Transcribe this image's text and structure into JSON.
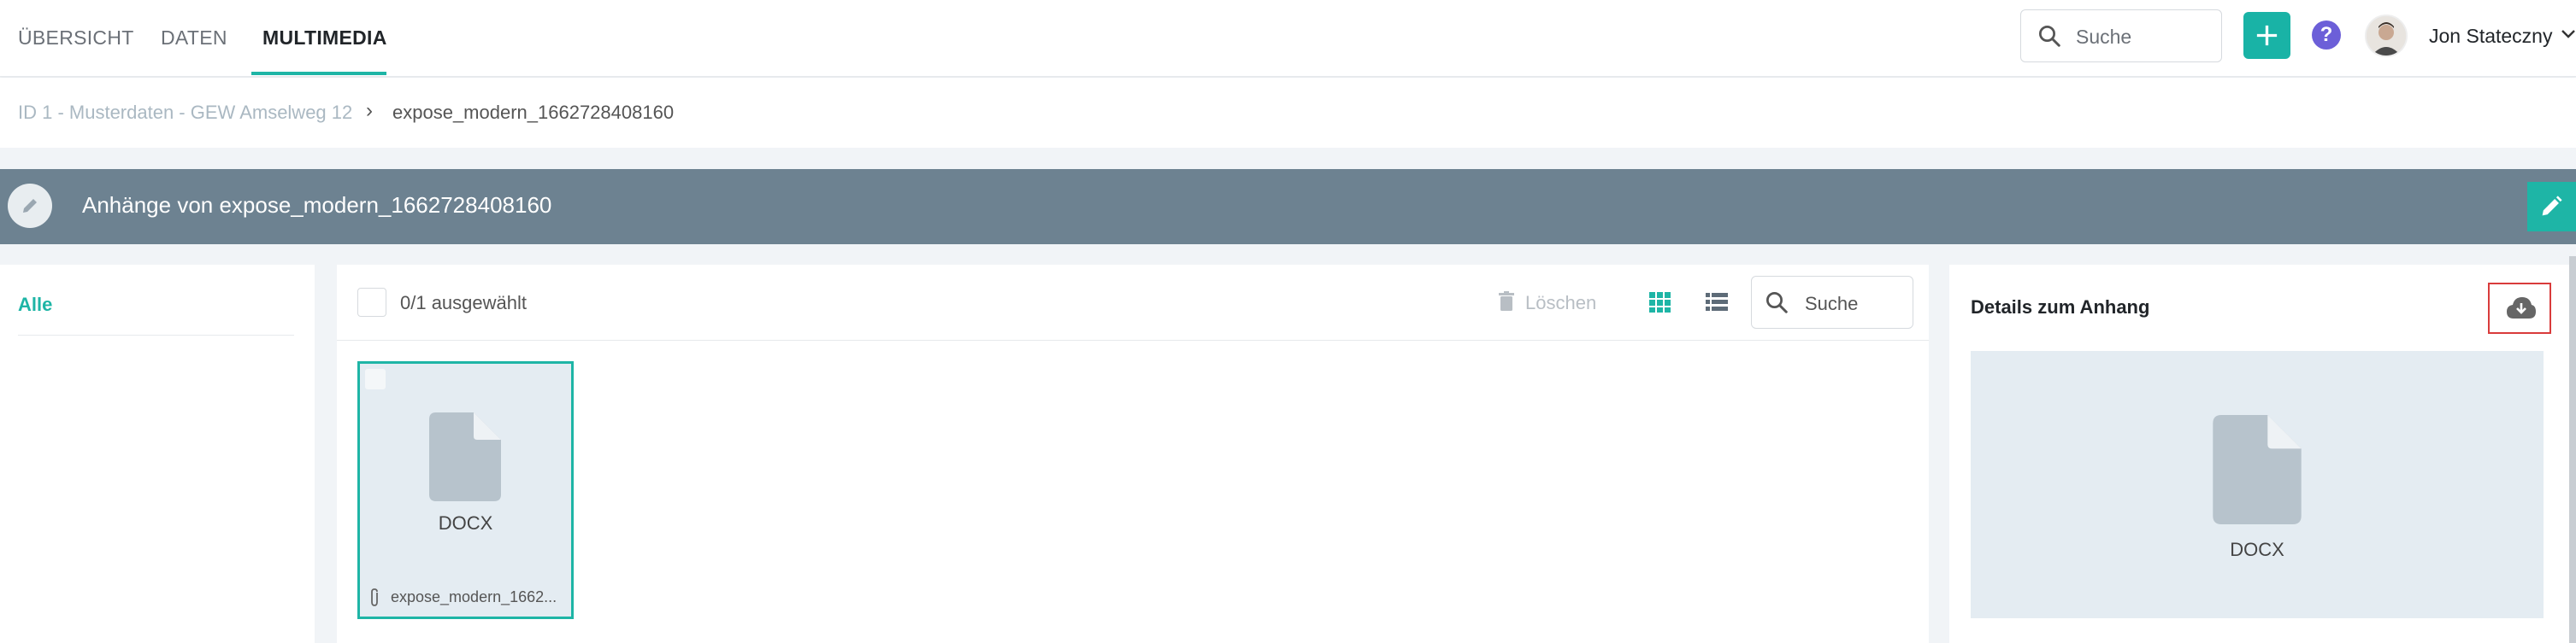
{
  "nav": {
    "tabs": [
      {
        "label": "ÜBERSICHT"
      },
      {
        "label": "DATEN"
      },
      {
        "label": "MULTIMEDIA",
        "active": true
      }
    ],
    "search_placeholder": "Suche",
    "help_label": "?",
    "user_name": "Jon Stateczny"
  },
  "breadcrumb": {
    "parent": "ID 1 - Musterdaten - GEW Amselweg 12",
    "separator": "›",
    "current": "expose_modern_1662728408160"
  },
  "header": {
    "title": "Anhänge von expose_modern_1662728408160"
  },
  "sidebar": {
    "filter_all": "Alle"
  },
  "files": {
    "selection_count": "0/1 ausgewählt",
    "delete_label": "Löschen",
    "search_placeholder": "Suche",
    "items": [
      {
        "type": "DOCX",
        "name": "expose_modern_1662..."
      }
    ]
  },
  "details": {
    "title": "Details zum Anhang",
    "preview_type": "DOCX"
  },
  "colors": {
    "accent": "#1eb5a6",
    "header_band": "#6d8291",
    "help": "#6c5fd8",
    "highlight": "#d93b3b"
  }
}
